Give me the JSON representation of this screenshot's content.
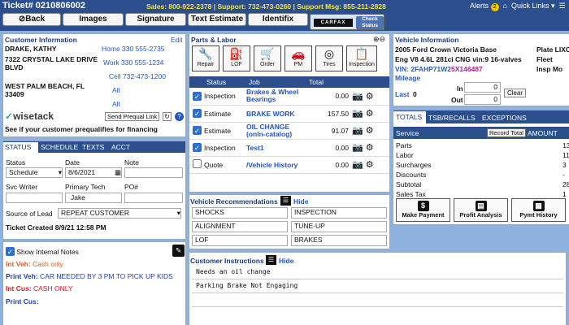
{
  "header": {
    "ticket": "Ticket# 0210806002",
    "contact_line": "Sales: 800-922-2378 | Support: 732-473-0260 | Support Msg: 855-211-2828",
    "alerts_label": "Alerts",
    "alerts_count": "2",
    "quick_links": "Quick Links ▾"
  },
  "tabs": [
    "Back",
    "Images",
    "Signature",
    "Text Estimate",
    "Identifix"
  ],
  "carfax": {
    "logo": "CARFAX",
    "check_status": "Check Status"
  },
  "customer": {
    "title": "Customer Information",
    "edit": "Edit",
    "name": "DRAKE, KATHY",
    "address1": "7322 CRYSTAL LAKE DRIVE",
    "address2": "BLVD",
    "city": "WEST PALM BEACH, FL",
    "zip": "33409",
    "home": "Home 330 555-2735",
    "work": "Work 330 555-1234",
    "cell": "Cell 732-473-1200",
    "alt1": "Alt",
    "alt2": "Alt",
    "wisetack_logo": "wisetack",
    "prequal_btn": "Send Prequal Link",
    "prequal_text": "See if your customer prequalifies for financing"
  },
  "status_panel": {
    "tabs": [
      "STATUS",
      "SCHEDULE",
      "TEXTS",
      "ACCT"
    ],
    "status_label": "Status",
    "status_value": "Schedule",
    "date_label": "Date",
    "date_value": "8/6/2021",
    "note_label": "Note",
    "svc_writer_label": "Svc Writer",
    "primary_tech_label": "Primary Tech",
    "primary_tech_value": "Jake",
    "po_label": "PO#",
    "source_label": "Source of Lead",
    "source_value": "REPEAT CUSTOMER",
    "created": "Ticket Created  8/9/21 12:58 PM"
  },
  "notes": {
    "show_internal": "Show Internal Notes",
    "int_veh_label": "Int Veh:",
    "int_veh": " Cash only",
    "print_veh_label": "Print Veh:",
    "print_veh": " CAR NEEDED BY 3 PM TO PICK UP KIDS",
    "int_cus_label": "Int Cus:",
    "int_cus": " CASH ONLY",
    "print_cus_label": "Print Cus:"
  },
  "parts": {
    "title": "Parts & Labor",
    "icons": [
      {
        "label": "Repair",
        "icon": "wrench-icon",
        "glyph": "🔧"
      },
      {
        "label": "LOF",
        "icon": "oil-can-icon",
        "glyph": "⛽"
      },
      {
        "label": "Order",
        "icon": "cart-icon",
        "glyph": "🛒"
      },
      {
        "label": "PM",
        "icon": "car-icon",
        "glyph": "🚗"
      },
      {
        "label": "Tires",
        "icon": "tire-icon",
        "glyph": "◎"
      },
      {
        "label": "Inspection",
        "icon": "clipboard-icon",
        "glyph": "📋"
      }
    ],
    "columns": [
      "Status",
      "Job",
      "Total"
    ],
    "rows": [
      {
        "checked": true,
        "status": "Inspection",
        "job": "Brakes & Wheel Bearings",
        "total": "0.00"
      },
      {
        "checked": true,
        "status": "Estimate",
        "job": "BRAKE WORK",
        "total": "157.50"
      },
      {
        "checked": true,
        "status": "Estimate",
        "job": "OIL CHANGE (onln-catalog)",
        "total": "91.07"
      },
      {
        "checked": true,
        "status": "Inspection",
        "job": "Test1",
        "total": "0.00"
      },
      {
        "checked": false,
        "status": "Quote",
        "job": "/Vehicle History",
        "total": "0.00"
      }
    ]
  },
  "recs": {
    "title": "Vehicle Recommendations",
    "hide": "Hide",
    "items": [
      "SHOCKS",
      "INSPECTION",
      "ALIGNMENT",
      "TUNE-UP",
      "LOF",
      "BRAKES"
    ]
  },
  "instructions": {
    "title": "Customer Instructions",
    "hide": "Hide",
    "lines": [
      "Needs an oil change",
      "Parking Brake Not Engaging"
    ]
  },
  "vehicle": {
    "title": "Vehicle Information",
    "model": "2005 Ford Crown Victoria Base",
    "plate": "Plate LIXC",
    "engine": "Eng V8 4.6L 281ci CNG vin:9 16-valves",
    "fleet": "Fleet",
    "vin_label": "VIN: ",
    "vin_a": "2FAHP71W2",
    "vin_b": "5X146487",
    "insp": "Insp Mo",
    "mileage": "Mileage",
    "last": "Last",
    "last_value": "0",
    "in_label": "In",
    "in_value": "0",
    "out_label": "Out",
    "out_value": "0",
    "clear": "Clear"
  },
  "totals": {
    "tabs": [
      "TOTALS",
      "TSB/RECALLS",
      "EXCEPTIONS"
    ],
    "service": "Service",
    "record_total": "Record Total",
    "amount": "AMOUNT",
    "rows": [
      {
        "label": "Parts",
        "value": "13"
      },
      {
        "label": "Labor",
        "value": "11"
      },
      {
        "label": "Surcharges",
        "value": "3"
      },
      {
        "label": "Discounts",
        "value": "-"
      },
      {
        "label": "Subtotal",
        "value": "28"
      },
      {
        "label": "Sales Tax",
        "value": "1"
      }
    ],
    "buttons": [
      {
        "label": "Make Payment",
        "glyph": "$"
      },
      {
        "label": "Profit Analysis",
        "glyph": "▤"
      },
      {
        "label": "Pymt History",
        "glyph": "▦"
      }
    ]
  }
}
